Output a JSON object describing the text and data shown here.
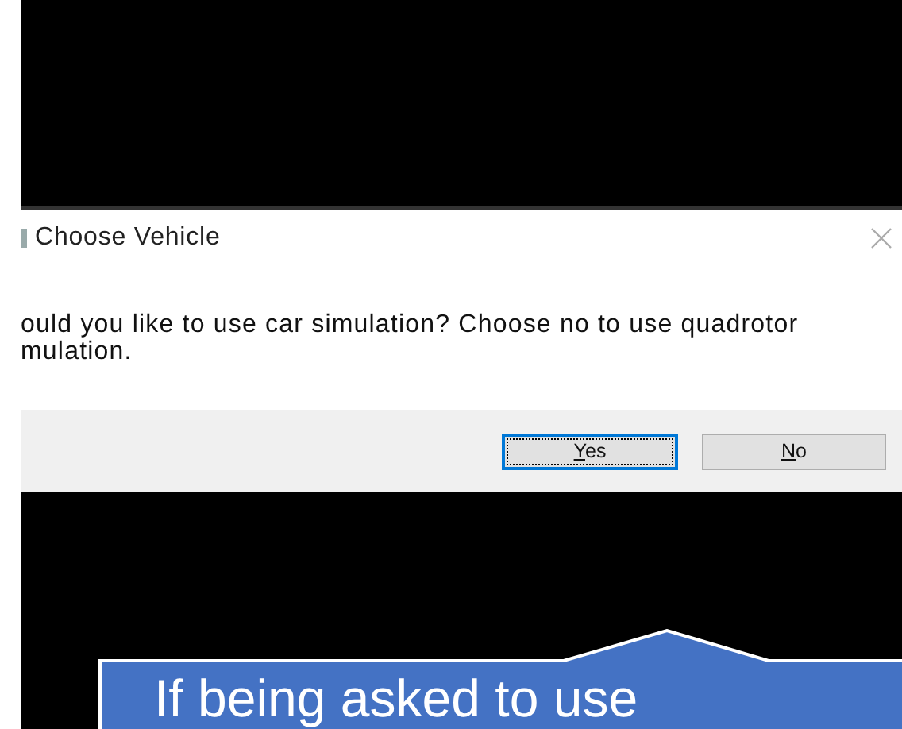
{
  "dialog": {
    "title": "Choose Vehicle",
    "message_lines": [
      "ould you like to use car simulation? Choose no to use quadrotor",
      "mulation."
    ],
    "buttons": [
      {
        "label": "Yes",
        "selected": true
      },
      {
        "label": "No",
        "selected": false
      }
    ]
  },
  "callout": {
    "text": "If being asked to use"
  }
}
